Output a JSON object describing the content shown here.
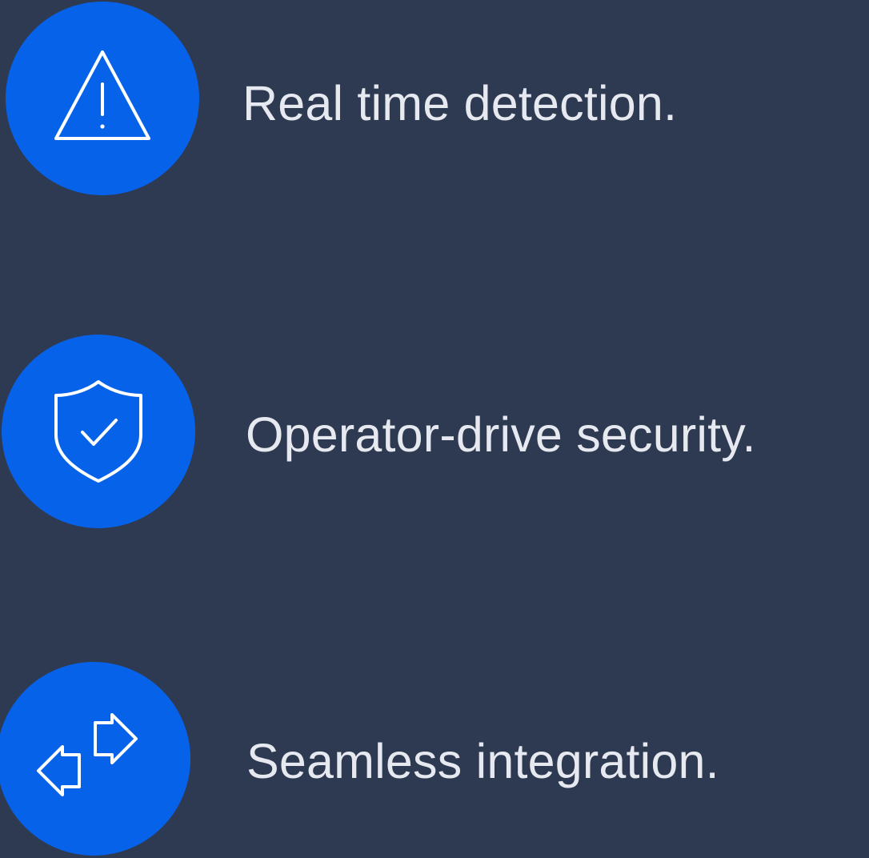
{
  "colors": {
    "background": "#2e3a51",
    "accent": "#0762ea",
    "text": "#e6e9ef",
    "icon_stroke": "#ffffff"
  },
  "features": [
    {
      "icon": "warning-triangle-icon",
      "label": "Real time detection."
    },
    {
      "icon": "shield-check-icon",
      "label": "Operator-drive security."
    },
    {
      "icon": "exchange-arrows-icon",
      "label": "Seamless integration."
    }
  ]
}
